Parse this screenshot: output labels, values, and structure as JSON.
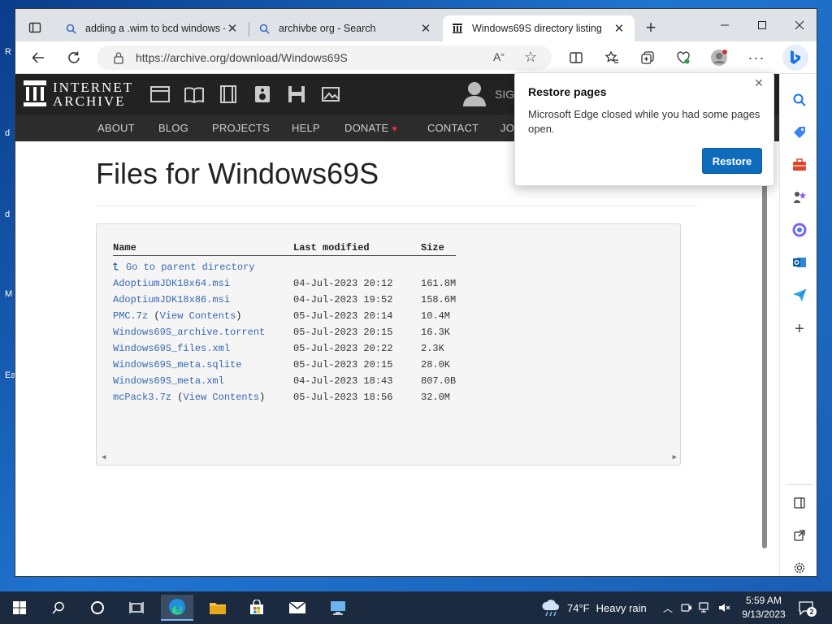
{
  "desktop": {
    "fragments": [
      "R",
      "d",
      "d",
      "M",
      "Ea"
    ]
  },
  "browser": {
    "tabs": [
      {
        "label": "adding a .wim to bcd windows -",
        "icon": "search-icon"
      },
      {
        "label": "archivbe org - Search",
        "icon": "search-icon"
      },
      {
        "label": "Windows69S directory listing",
        "icon": "internet-archive-icon"
      }
    ],
    "url": "https://archive.org/download/Windows69S"
  },
  "ia": {
    "logo_line1": "INTERNET",
    "logo_line2": "ARCHIVE",
    "sign_in": "SIG",
    "nav": [
      "ABOUT",
      "BLOG",
      "PROJECTS",
      "HELP",
      "DONATE",
      "CONTACT",
      "JO"
    ]
  },
  "page": {
    "title": "Files for Windows69S",
    "headers": {
      "name": "Name",
      "modified": "Last modified",
      "size": "Size"
    },
    "parent_link": "Go to parent directory",
    "files": [
      {
        "name": "AdoptiumJDK18x64.msi",
        "extra": "",
        "modified": "04-Jul-2023 20:12",
        "size": "161.8M"
      },
      {
        "name": "AdoptiumJDK18x86.msi",
        "extra": "",
        "modified": "04-Jul-2023 19:52",
        "size": "158.6M"
      },
      {
        "name": "PMC.7z",
        "extra": "View Contents",
        "modified": "05-Jul-2023 20:14",
        "size": "10.4M"
      },
      {
        "name": "Windows69S_archive.torrent",
        "extra": "",
        "modified": "05-Jul-2023 20:15",
        "size": "16.3K"
      },
      {
        "name": "Windows69S_files.xml",
        "extra": "",
        "modified": "05-Jul-2023 20:22",
        "size": "2.3K"
      },
      {
        "name": "Windows69S_meta.sqlite",
        "extra": "",
        "modified": "05-Jul-2023 20:15",
        "size": "28.0K"
      },
      {
        "name": "Windows69S_meta.xml",
        "extra": "",
        "modified": "04-Jul-2023 18:43",
        "size": "807.0B"
      },
      {
        "name": "mcPack3.7z",
        "extra": "View Contents",
        "modified": "05-Jul-2023 18:56",
        "size": "32.0M"
      }
    ]
  },
  "popup": {
    "title": "Restore pages",
    "message": "Microsoft Edge closed while you had some pages open.",
    "button": "Restore"
  },
  "taskbar": {
    "weather_temp": "74°F",
    "weather_desc": "Heavy rain",
    "time": "5:59 AM",
    "date": "9/13/2023",
    "notification_count": "2"
  },
  "colors": {
    "accent": "#0f6cbd",
    "link": "#3567b5",
    "ia_header": "#222222",
    "taskbar": "#1b2a3e"
  }
}
